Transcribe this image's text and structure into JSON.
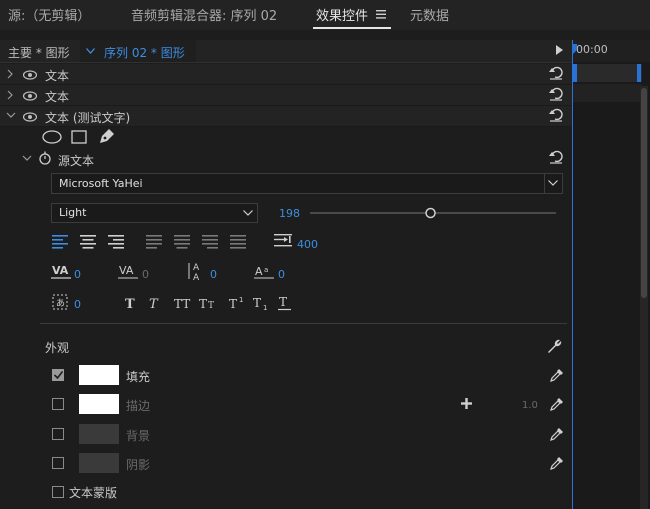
{
  "tabs": [
    {
      "label": "源:（无剪辑）"
    },
    {
      "label": "音频剪辑混合器: 序列 02"
    },
    {
      "label": "效果控件"
    },
    {
      "label": "元数据"
    }
  ],
  "tab_menu_icon": "hamburger-icon",
  "header": {
    "master_label": "主要 * 图形",
    "sequence_label": "序列 02 * 图形",
    "timecode": "00:00"
  },
  "layers": [
    {
      "label": "文本"
    },
    {
      "label": "文本"
    },
    {
      "label": "文本 (测试文字)"
    }
  ],
  "source_text": {
    "label": "源文本",
    "font_family": "Microsoft YaHei",
    "font_style": "Light",
    "font_size": "198",
    "font_size_fraction": 0.49,
    "tab_width": "400",
    "kerning": "0",
    "tracking": "0",
    "leading": "0",
    "baseline_shift": "0",
    "tsume": "0"
  },
  "appearance": {
    "title": "外观",
    "fill_label": "填充",
    "fill_checked": true,
    "stroke_label": "描边",
    "stroke_checked": false,
    "stroke_width": "1.0",
    "background_label": "背景",
    "background_checked": false,
    "shadow_label": "阴影",
    "shadow_checked": false,
    "mask_label": "文本蒙版",
    "mask_checked": false
  },
  "colors": {
    "accent": "#3d8ee0",
    "panel": "#1d1d1d",
    "row": "#232323",
    "fill": "#ffffff",
    "stroke": "#ffffff"
  }
}
